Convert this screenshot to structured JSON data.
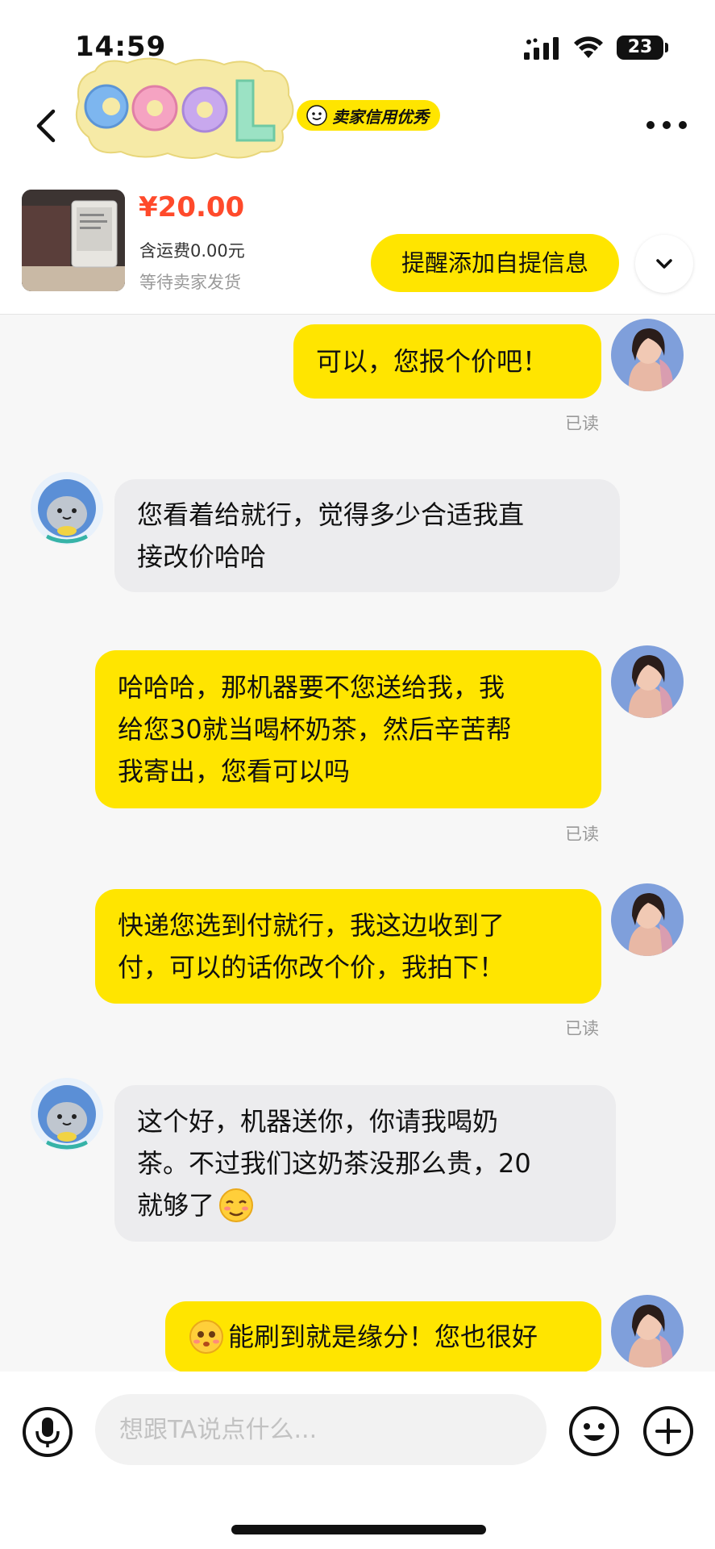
{
  "status_bar": {
    "time": "14:59",
    "battery": "23"
  },
  "header": {
    "credit_badge": "卖家信用优秀",
    "logo_text": "COOL"
  },
  "product": {
    "price": "¥20.00",
    "shipping": "含运费0.00元",
    "status": "等待卖家发货",
    "remind_button": "提醒添加自提信息"
  },
  "messages": [
    {
      "from": "me",
      "text": "可以，您报个价吧！",
      "read": "已读"
    },
    {
      "from": "them",
      "lines": [
        "您看着给就行，觉得多少合适我直",
        "接改价哈哈"
      ]
    },
    {
      "from": "me",
      "lines": [
        "哈哈哈，那机器要不您送给我，我",
        "给您30就当喝杯奶茶，然后辛苦帮",
        "我寄出，您看可以吗"
      ],
      "read": "已读"
    },
    {
      "from": "me",
      "lines": [
        "快递您选到付就行，我这边收到了",
        "付，可以的话你改个价，我拍下！"
      ],
      "read": "已读"
    },
    {
      "from": "them",
      "lines": [
        "这个好，机器送你，你请我喝奶",
        "茶。不过我们这奶茶没那么贵，20",
        "就够了"
      ]
    },
    {
      "from": "me",
      "text": "能刷到就是缘分！您也很好"
    }
  ],
  "input": {
    "placeholder": "想跟TA说点什么..."
  },
  "colors": {
    "accent": "#ffe500",
    "price": "#ff4a2b"
  },
  "icons": [
    "back-icon",
    "more-icon",
    "chevron-down-icon",
    "microphone-icon",
    "emoji-icon",
    "plus-icon"
  ]
}
